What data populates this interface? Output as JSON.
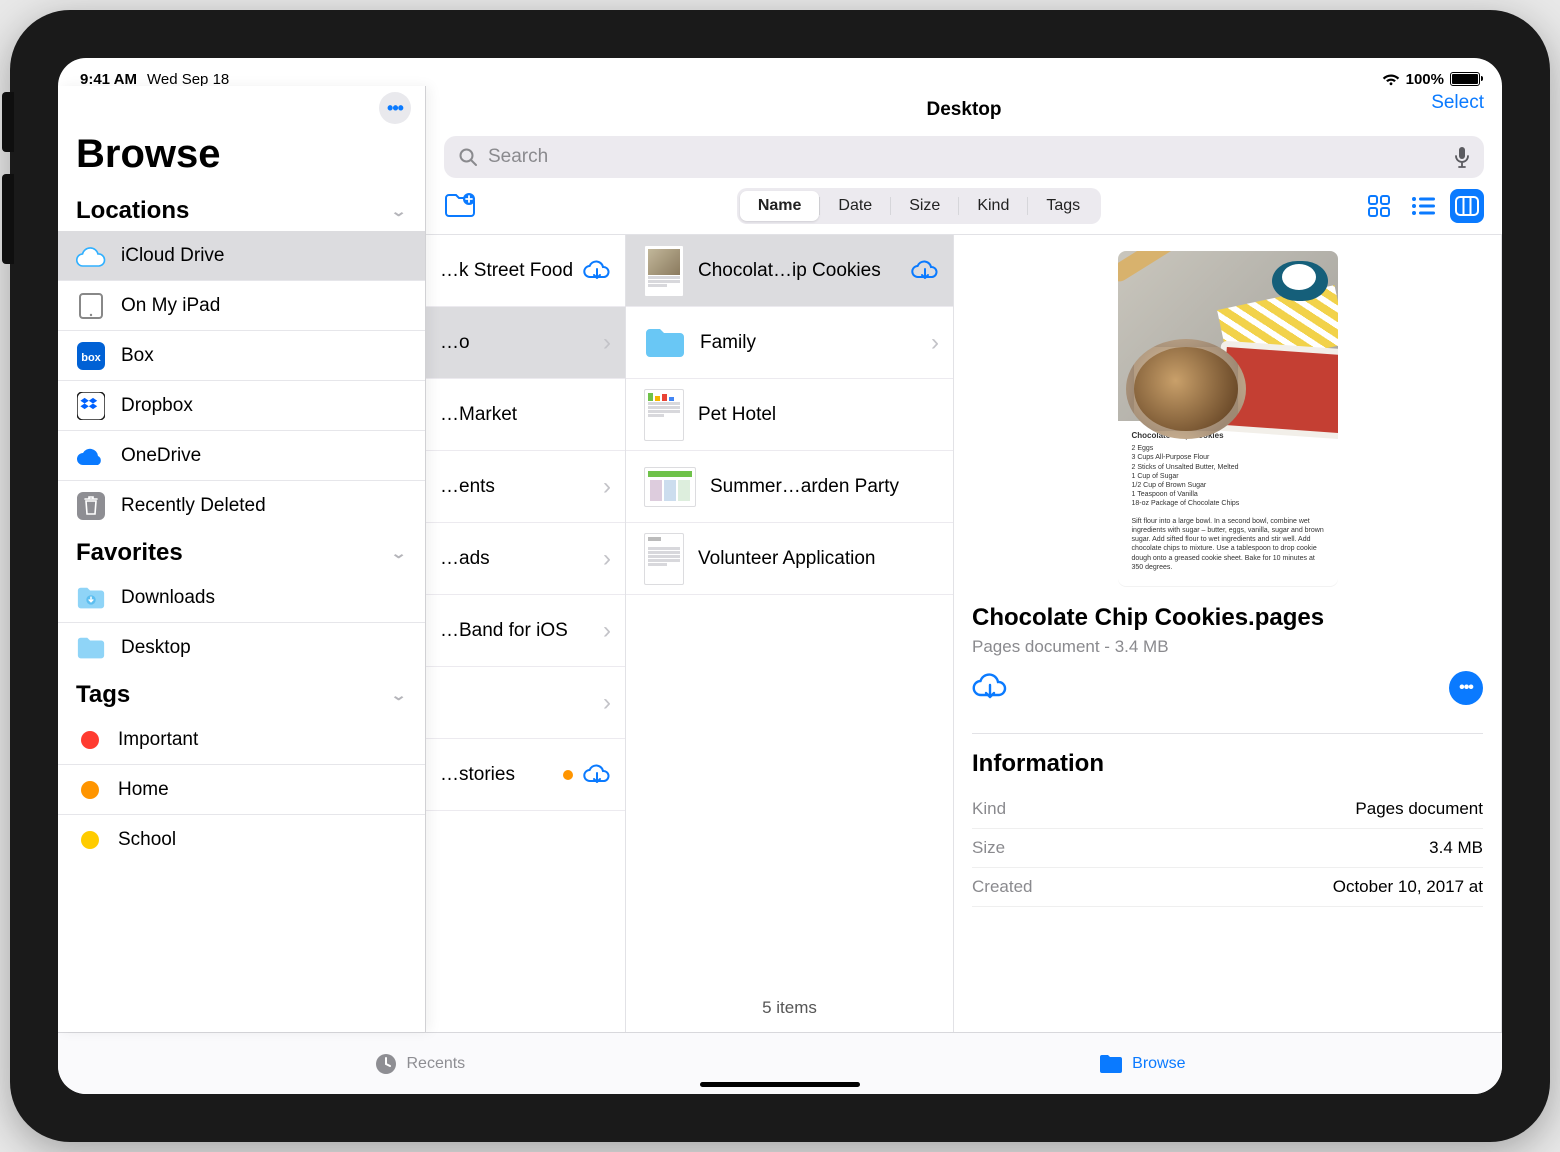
{
  "status": {
    "time": "9:41 AM",
    "date": "Wed Sep 18",
    "battery": "100%"
  },
  "sidebar": {
    "title": "Browse",
    "sections": {
      "locations_label": "Locations",
      "favorites_label": "Favorites",
      "tags_label": "Tags"
    },
    "locations": [
      {
        "label": "iCloud Drive"
      },
      {
        "label": "On My iPad"
      },
      {
        "label": "Box"
      },
      {
        "label": "Dropbox"
      },
      {
        "label": "OneDrive"
      },
      {
        "label": "Recently Deleted"
      }
    ],
    "favorites": [
      {
        "label": "Downloads"
      },
      {
        "label": "Desktop"
      }
    ],
    "tags": [
      {
        "label": "Important",
        "color": "#ff3b30"
      },
      {
        "label": "Home",
        "color": "#ff9500"
      },
      {
        "label": "School",
        "color": "#ffcc00"
      }
    ]
  },
  "header": {
    "title": "Desktop",
    "select": "Select",
    "search_placeholder": "Search",
    "sort": {
      "options": [
        "Name",
        "Date",
        "Size",
        "Kind",
        "Tags"
      ],
      "active": "Name"
    }
  },
  "col1": [
    {
      "label": "…k Street Food",
      "cloud": true
    },
    {
      "label": "…o",
      "chevron": true,
      "selected": true
    },
    {
      "label": "…Market"
    },
    {
      "label": "…ents",
      "chevron": true
    },
    {
      "label": "…ads",
      "chevron": true
    },
    {
      "label": "…Band for iOS",
      "chevron": true
    },
    {
      "label": "",
      "chevron": true
    },
    {
      "label": "…stories",
      "orange": true,
      "cloud": true
    }
  ],
  "col2": {
    "items": [
      {
        "label": "Chocolat…ip Cookies",
        "cloud": true,
        "selected": true,
        "thumb": "doc-photo"
      },
      {
        "label": "Family",
        "folder": true,
        "chevron": true
      },
      {
        "label": "Pet Hotel",
        "thumb": "doc-chart"
      },
      {
        "label": "Summer…arden Party",
        "thumb": "doc-wide"
      },
      {
        "label": "Volunteer Application",
        "thumb": "doc-lines"
      }
    ],
    "footer": "5 items"
  },
  "detail": {
    "name": "Chocolate Chip Cookies.pages",
    "sub": "Pages document - 3.4 MB",
    "info_label": "Information",
    "rows": [
      {
        "k": "Kind",
        "v": "Pages document"
      },
      {
        "k": "Size",
        "v": "3.4 MB"
      },
      {
        "k": "Created",
        "v": "October 10, 2017 at"
      }
    ]
  },
  "tabs": {
    "recents": "Recents",
    "browse": "Browse"
  }
}
